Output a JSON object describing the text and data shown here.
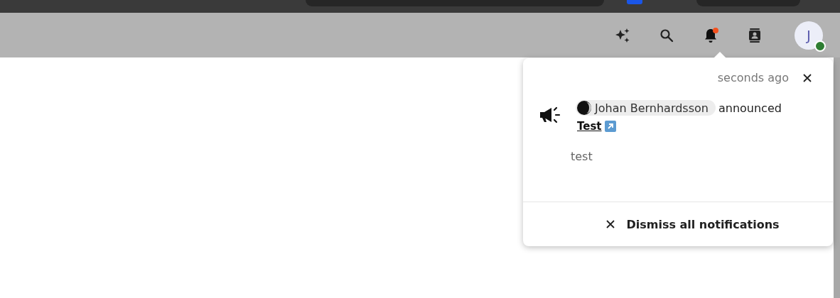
{
  "header": {
    "icons": [
      {
        "kind": "sparkle"
      },
      {
        "kind": "search"
      },
      {
        "kind": "bell",
        "unread": true
      },
      {
        "kind": "contacts"
      }
    ],
    "avatar": {
      "initial": "J",
      "color": "#2e7d32"
    }
  },
  "notification_popup": {
    "time": "seconds ago",
    "actor": "Johan Bernhardsson",
    "verb": "announced",
    "link": "Test",
    "message": "test",
    "dismiss_all": "Dismiss all notifications"
  }
}
